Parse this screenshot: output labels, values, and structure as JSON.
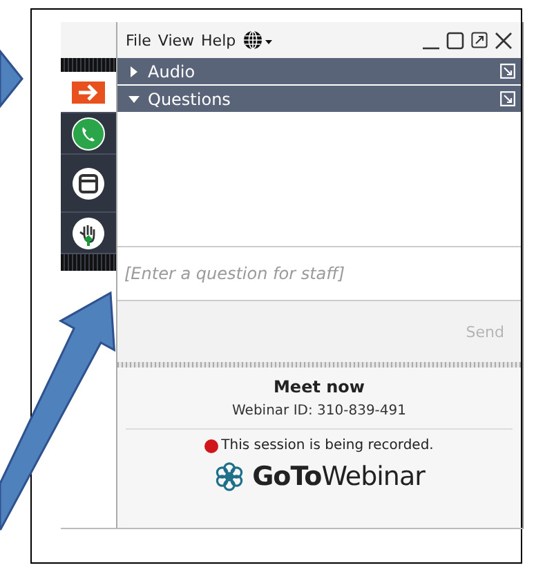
{
  "menu": [
    "File",
    "View",
    "Help"
  ],
  "sidebar": {
    "tabs": [
      {
        "kind": "arrow",
        "selected": true
      },
      {
        "kind": "phone",
        "selected": false
      },
      {
        "kind": "window",
        "selected": false
      },
      {
        "kind": "hand",
        "selected": false
      }
    ]
  },
  "panes": [
    {
      "title": "Audio",
      "expanded": false
    },
    {
      "title": "Questions",
      "expanded": true
    }
  ],
  "question": {
    "placeholder": "[Enter a question for staff]"
  },
  "send_button": "Send",
  "session": {
    "title": "Meet now",
    "webinar_id": "Webinar ID: 310-839-491",
    "recording": true,
    "recording_text": "This session is being recorded."
  },
  "brand": "**GoTo**Webinar"
}
